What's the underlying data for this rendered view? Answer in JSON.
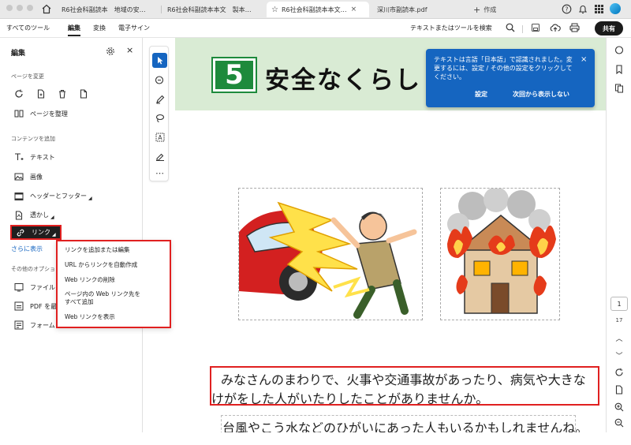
{
  "tabs": [
    {
      "label": "R6社会科副読本　地域の安…"
    },
    {
      "label": "R6社会科副読本本文　製本…"
    },
    {
      "label": "R6社会科副読本本文…"
    },
    {
      "label": "深川市副読本.pdf"
    }
  ],
  "new_tab_label": "作成",
  "menubar": {
    "items": [
      "すべてのツール",
      "編集",
      "変換",
      "電子サイン"
    ],
    "search_placeholder": "テキストまたはツールを検索",
    "share_label": "共有"
  },
  "panel": {
    "title": "編集",
    "section_page": "ページを変更",
    "organize_label": "ページを整理",
    "section_content": "コンテンツを追加",
    "content_items": [
      "テキスト",
      "画像",
      "ヘッダーとフッター",
      "透かし",
      "リンク"
    ],
    "show_more": "さらに表示",
    "section_other": "その他のオプション",
    "other_items": [
      "ファイル",
      "PDF を最",
      "フォーム"
    ]
  },
  "context_menu": {
    "items": [
      "リンクを追加または編集",
      "URL からリンクを自動作成",
      "Web リンクの削除",
      "ページ内の Web リンク先を",
      "すべて追加",
      "Web リンクを表示"
    ]
  },
  "document": {
    "chapter_number": "5",
    "chapter_title": "安全なくらし",
    "line1": "みなさんのまわりで、火事や交通事故があったり、病気や大きな",
    "line2": "けがをした人がいたりしたことがありませんか。",
    "line3": "台風やこう水などのひがいにあった人もいるかもしれませんね。"
  },
  "notification": {
    "message": "テキストは言語「日本語」で認識されました。変更するには、設定 / その他の設定をクリックしてください。",
    "settings_button": "設定",
    "dismiss_button": "次回から表示しない"
  },
  "pager": {
    "current_page": "1",
    "total_pages": "17"
  },
  "colors": {
    "accent": "#1565c0",
    "chapter_green": "#1e8a3c",
    "header_green": "#d9ebd4",
    "highlight_red": "#e02020"
  }
}
